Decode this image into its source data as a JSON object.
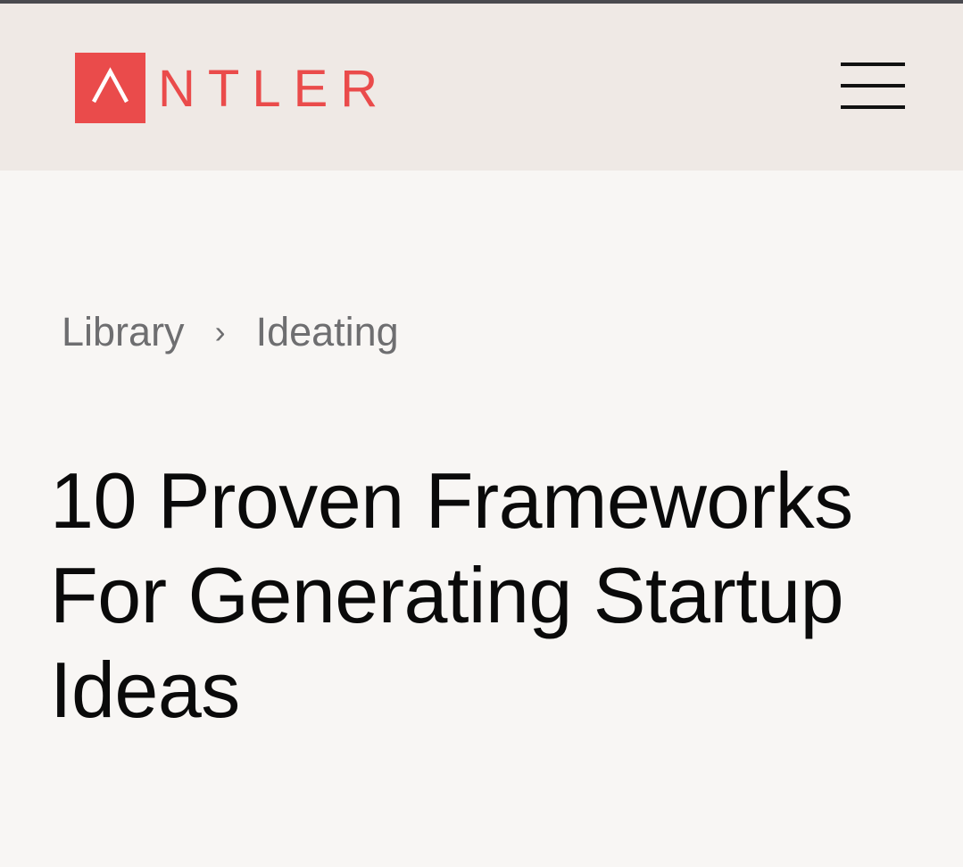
{
  "header": {
    "logo": {
      "mark": "Λ",
      "text": "NTLER",
      "color": "#ea4b4b"
    },
    "menu_icon": "hamburger-menu-icon"
  },
  "breadcrumb": {
    "items": [
      "Library",
      "Ideating"
    ],
    "separator": "›"
  },
  "article": {
    "title": "10 Proven Frameworks For Generating Startup Ideas"
  },
  "colors": {
    "header_bg": "#efe9e5",
    "page_bg": "#f8f6f4",
    "brand": "#ea4b4b",
    "text": "#0a0a0a",
    "muted": "#6e6e70"
  }
}
